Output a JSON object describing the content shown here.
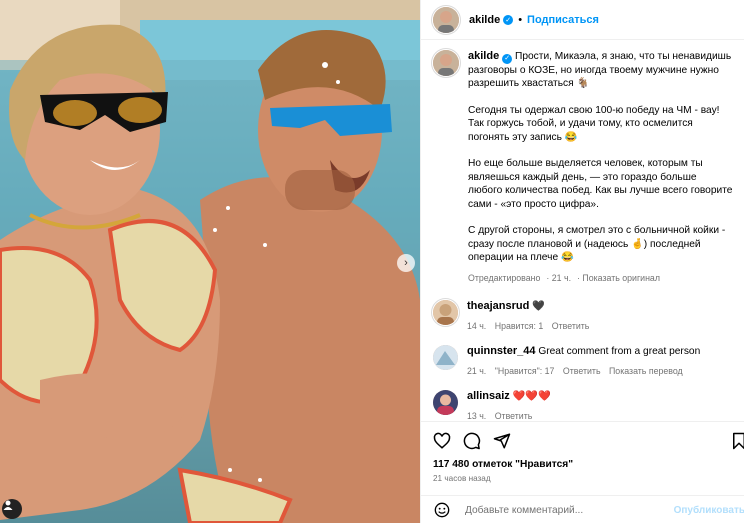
{
  "post": {
    "username": "akilde",
    "follow_label": "Подписаться",
    "caption_lines": [
      "Прости, Микаэла, я знаю, что ты ненавидишь разговоры о КОЗЕ, но иногда твоему мужчине нужно разрешить хвастаться 🐐",
      "Сегодня ты одержал свою 100-ю победу на ЧМ - вау! Так горжусь тобой, и удачи тому, кто осмелится погонять эту запись 😂",
      "Но еще больше выделяется человек, которым ты являешься каждый день, — это гораздо больше любого количества побед. Как вы лучше всего говорите сами - «это просто цифра».",
      "С другой стороны, я смотрел это с больничной койки - сразу после плановой и (надеюсь 🤞) последней операции на плече 😂"
    ],
    "caption_meta": {
      "edited": "Отредактировано",
      "time": "21 ч.",
      "translate": "Показать оригинал"
    }
  },
  "comments": [
    {
      "user": "theajansrud",
      "text": "🖤",
      "time": "14 ч.",
      "likes": "Нравится: 1",
      "reply": "Ответить",
      "extra": "",
      "avatar_color": "#c9a27a"
    },
    {
      "user": "quinnster_44",
      "text": "Great comment from a great person",
      "time": "21 ч.",
      "likes": "\"Нравится\": 17",
      "reply": "Ответить",
      "extra": "Показать перевод",
      "avatar_color": "#8fb3c9"
    },
    {
      "user": "allinsaiz",
      "text": "❤️❤️❤️",
      "time": "13 ч.",
      "likes": "",
      "reply": "Ответить",
      "extra": "",
      "avatar_color": "#5a5f8a"
    }
  ],
  "footer": {
    "likes": "117 480 отметок \"Нравится\"",
    "time": "21 часов назад",
    "add_comment_placeholder": "Добавьте комментарий...",
    "publish": "Опубликовать"
  },
  "icons": {
    "like": "heart-icon",
    "comment": "comment-icon",
    "share": "share-icon",
    "save": "bookmark-icon",
    "emoji": "emoji-icon",
    "carousel": "chevron-right-icon",
    "tags": "user-tag-icon"
  },
  "colors": {
    "accent": "#0095f6",
    "muted": "#737373",
    "border": "#efefef"
  }
}
